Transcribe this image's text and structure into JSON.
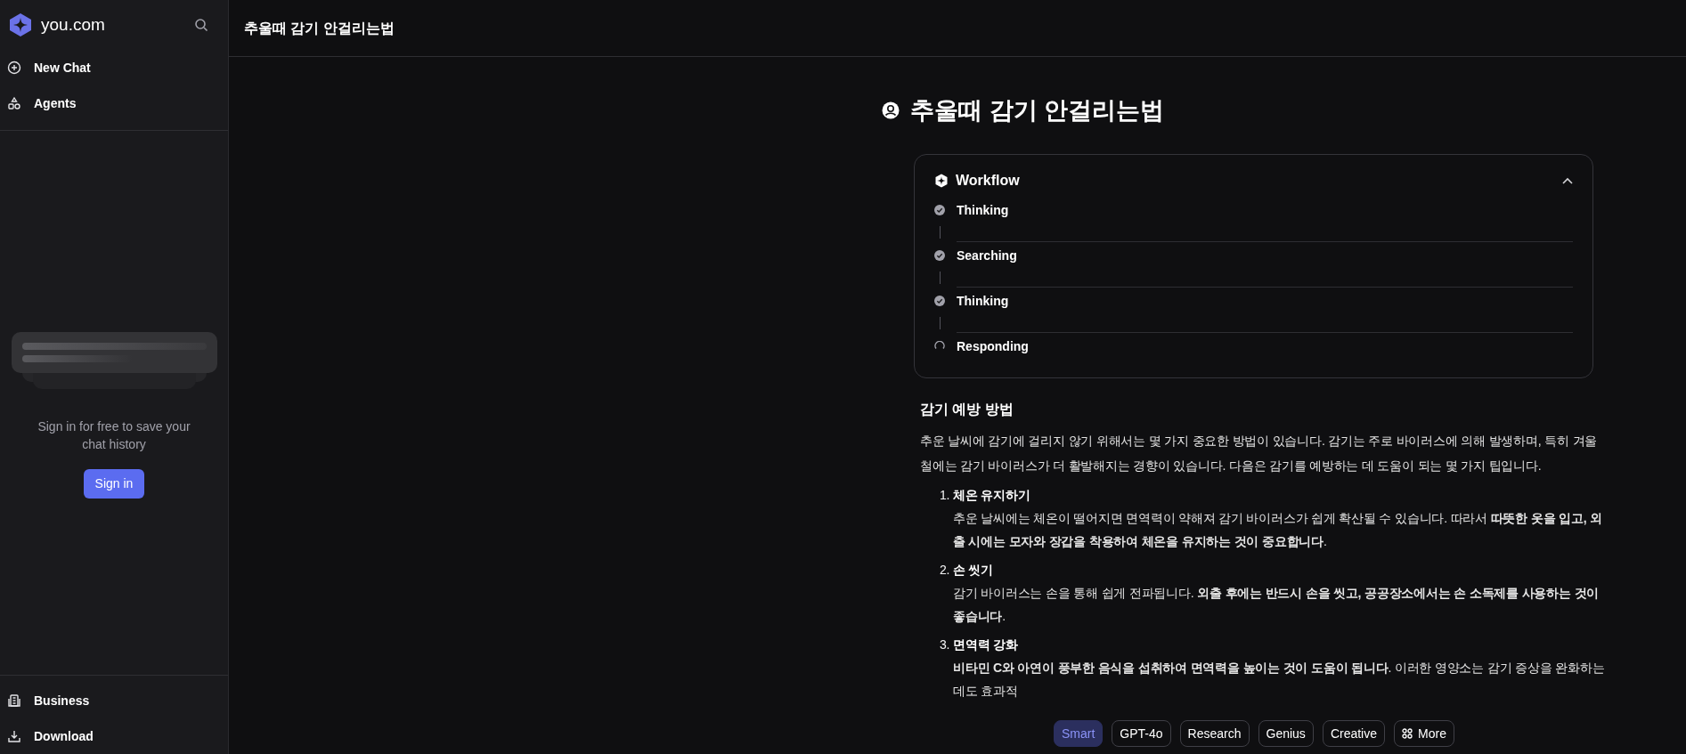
{
  "sidebar": {
    "brand": "you.com",
    "nav": [
      {
        "label": "New Chat"
      },
      {
        "label": "Agents"
      }
    ],
    "signin_prompt": "Sign in for free to save your chat history",
    "signin_button": "Sign in",
    "footer": [
      {
        "label": "Business"
      },
      {
        "label": "Download"
      }
    ]
  },
  "header": {
    "title": "추울때 감기 안걸리는법"
  },
  "query": {
    "title": "추울때 감기 안걸리는법"
  },
  "workflow": {
    "title": "Workflow",
    "expanded": true,
    "steps": [
      {
        "label": "Thinking",
        "kind": "done"
      },
      {
        "label": "Searching",
        "kind": "done"
      },
      {
        "label": "Thinking",
        "kind": "done"
      },
      {
        "label": "Responding",
        "kind": "running"
      }
    ]
  },
  "answer": {
    "heading": "감기 예방 방법",
    "intro": "추운 날씨에 감기에 걸리지 않기 위해서는 몇 가지 중요한 방법이 있습니다. 감기는 주로 바이러스에 의해 발생하며, 특히 겨울철에는 감기 바이러스가 더 활발해지는 경향이 있습니다. 다음은 감기를 예방하는 데 도움이 되는 몇 가지 팁입니다.",
    "tips": [
      {
        "number": "1.",
        "title": "체온 유지하기",
        "text": "추운 날씨에는 체온이 떨어지면 면역력이 약해져 감기 바이러스가 쉽게 확산될 수 있습니다. 따라서 **따뜻한 옷을 입고, 외출 시에는 모자와 장갑을 착용하여 체온을 유지하는 것이 중요합니다**."
      },
      {
        "number": "2.",
        "title": "손 씻기",
        "text": "감기 바이러스는 손을 통해 쉽게 전파됩니다. **외출 후에는 반드시 손을 씻고, 공공장소에서는 손 소독제를 사용하는 것이 좋습니다**."
      },
      {
        "number": "3.",
        "title": "면역력 강화",
        "text": "**비타민 C와 아연이 풍부한 음식을 섭취하여 면역력을 높이는 것이 도움이 됩니다**. 이러한 영양소는 감기 증상을 완화하는 데도 효과적"
      }
    ]
  },
  "modes": [
    {
      "label": "Smart",
      "selected": true
    },
    {
      "label": "GPT-4o",
      "selected": false
    },
    {
      "label": "Research",
      "selected": false
    },
    {
      "label": "Genius",
      "selected": false
    },
    {
      "label": "Creative",
      "selected": false
    },
    {
      "label": "More",
      "selected": false,
      "kind": "more"
    }
  ]
}
